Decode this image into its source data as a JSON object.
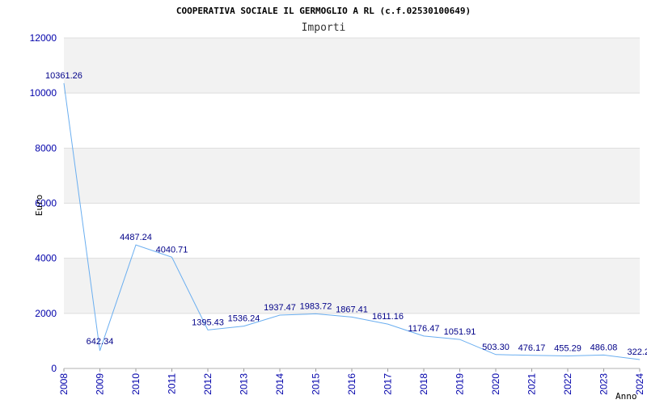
{
  "chart_data": {
    "type": "line",
    "title": "COOPERATIVA SOCIALE IL GERMOGLIO A RL (c.f.02530100649)",
    "subtitle": "Importi",
    "xlabel": "Anno",
    "ylabel": "Euro",
    "x": [
      "2008",
      "2009",
      "2010",
      "2011",
      "2012",
      "2013",
      "2014",
      "2015",
      "2016",
      "2017",
      "2018",
      "2019",
      "2020",
      "2021",
      "2022",
      "2023",
      "2024"
    ],
    "series": [
      {
        "values": [
          10361.26,
          642.34,
          4487.24,
          4040.71,
          1395.43,
          1536.24,
          1937.47,
          1983.72,
          1867.41,
          1611.16,
          1176.47,
          1051.91,
          503.3,
          476.17,
          455.29,
          486.08,
          322.2
        ],
        "labels": [
          "10361.26",
          "642.34",
          "4487.24",
          "4040.71",
          "1395.43",
          "1536.24",
          "1937.47",
          "1983.72",
          "1867.41",
          "1611.16",
          "1176.47",
          "1051.91",
          "503.30",
          "476.17",
          "455.29",
          "486.08",
          "322.2"
        ]
      }
    ],
    "ylim": [
      0,
      12000
    ],
    "yticks": [
      0,
      2000,
      4000,
      6000,
      8000,
      10000,
      12000
    ],
    "grid": true,
    "colors": {
      "line": "#6aaef0",
      "band": "#f2f2f2",
      "grid": "#dddddd",
      "tick_text": "#0000aa",
      "data_label": "#000088"
    }
  }
}
